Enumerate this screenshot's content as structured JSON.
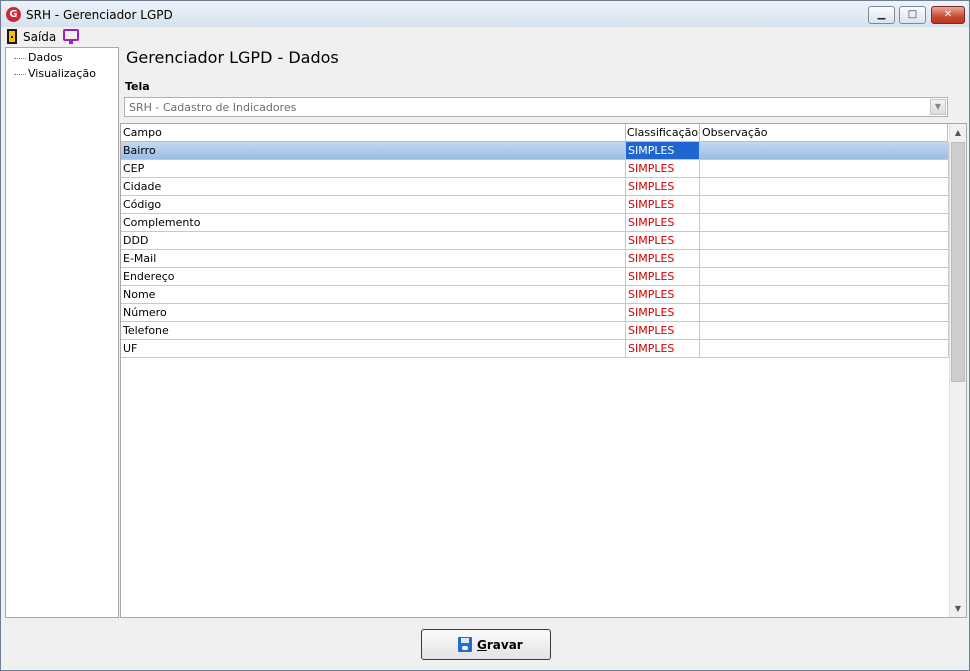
{
  "window": {
    "title": "SRH - Gerenciador LGPD",
    "icon_letter": "G"
  },
  "menu": {
    "saida_label": "Saída"
  },
  "tree": {
    "items": [
      "Dados",
      "Visualização"
    ]
  },
  "main": {
    "title": "Gerenciador LGPD - Dados",
    "tela_label": "Tela",
    "tela_value": "SRH - Cadastro de Indicadores"
  },
  "grid": {
    "headers": [
      "Campo",
      "Classificação",
      "Observação"
    ],
    "rows": [
      {
        "campo": "Bairro",
        "classificacao": "SIMPLES",
        "observacao": ""
      },
      {
        "campo": "CEP",
        "classificacao": "SIMPLES",
        "observacao": ""
      },
      {
        "campo": "Cidade",
        "classificacao": "SIMPLES",
        "observacao": ""
      },
      {
        "campo": "Código",
        "classificacao": "SIMPLES",
        "observacao": ""
      },
      {
        "campo": "Complemento",
        "classificacao": "SIMPLES",
        "observacao": ""
      },
      {
        "campo": "DDD",
        "classificacao": "SIMPLES",
        "observacao": ""
      },
      {
        "campo": "E-Mail",
        "classificacao": "SIMPLES",
        "observacao": ""
      },
      {
        "campo": "Endereço",
        "classificacao": "SIMPLES",
        "observacao": ""
      },
      {
        "campo": "Nome",
        "classificacao": "SIMPLES",
        "observacao": ""
      },
      {
        "campo": "Número",
        "classificacao": "SIMPLES",
        "observacao": ""
      },
      {
        "campo": "Telefone",
        "classificacao": "SIMPLES",
        "observacao": ""
      },
      {
        "campo": "UF",
        "classificacao": "SIMPLES",
        "observacao": ""
      }
    ],
    "selected_row": 0
  },
  "footer": {
    "gravar_first": "G",
    "gravar_rest": "ravar"
  },
  "colors": {
    "classification_text": "#cc0000",
    "selection": "#1f66d1",
    "accent_icon": "#d12434"
  }
}
